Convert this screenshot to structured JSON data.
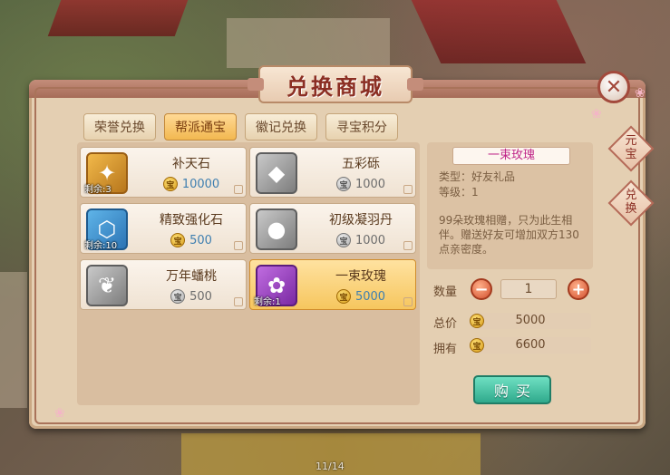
{
  "window": {
    "title": "兑换商城",
    "close_icon": "close-icon"
  },
  "tabs": [
    {
      "label": "荣誉兑换",
      "active": false
    },
    {
      "label": "帮派通宝",
      "active": true
    },
    {
      "label": "徽记兑换",
      "active": false
    },
    {
      "label": "寻宝积分",
      "active": false
    }
  ],
  "items": [
    {
      "name": "补天石",
      "price": "10000",
      "remain": "剩余:3",
      "coin": "gold",
      "icon": "crystal-icon",
      "selected": false
    },
    {
      "name": "五彩砾",
      "price": "1000",
      "remain": "",
      "coin": "gray",
      "icon": "stone-icon",
      "selected": false
    },
    {
      "name": "精致强化石",
      "price": "500",
      "remain": "剩余:10",
      "coin": "gold",
      "icon": "forge-stone-icon",
      "selected": false
    },
    {
      "name": "初级凝羽丹",
      "price": "1000",
      "remain": "",
      "coin": "gray",
      "icon": "pill-icon",
      "selected": false
    },
    {
      "name": "万年蟠桃",
      "price": "500",
      "remain": "",
      "coin": "gray",
      "icon": "peach-icon",
      "selected": false
    },
    {
      "name": "一束玫瑰",
      "price": "5000",
      "remain": "剩余:1",
      "coin": "gold",
      "icon": "rose-icon",
      "selected": true
    }
  ],
  "coin_symbol": "宝",
  "detail": {
    "title": "一束玫瑰",
    "type_line": "类型：好友礼品",
    "level_line": "等级：1",
    "description": "99朵玫瑰相赠，只为此生相伴。赠送好友可增加双方130点亲密度。"
  },
  "purchase": {
    "qty_label": "数量",
    "qty_value": "1",
    "minus_label": "−",
    "plus_label": "+",
    "total_label": "总价",
    "total_value": "5000",
    "own_label": "拥有",
    "own_value": "6600",
    "buy_label": "购买"
  },
  "side_tags": [
    {
      "label": "元\n宝"
    },
    {
      "label": "兑\n换"
    }
  ],
  "pager": "11/14"
}
